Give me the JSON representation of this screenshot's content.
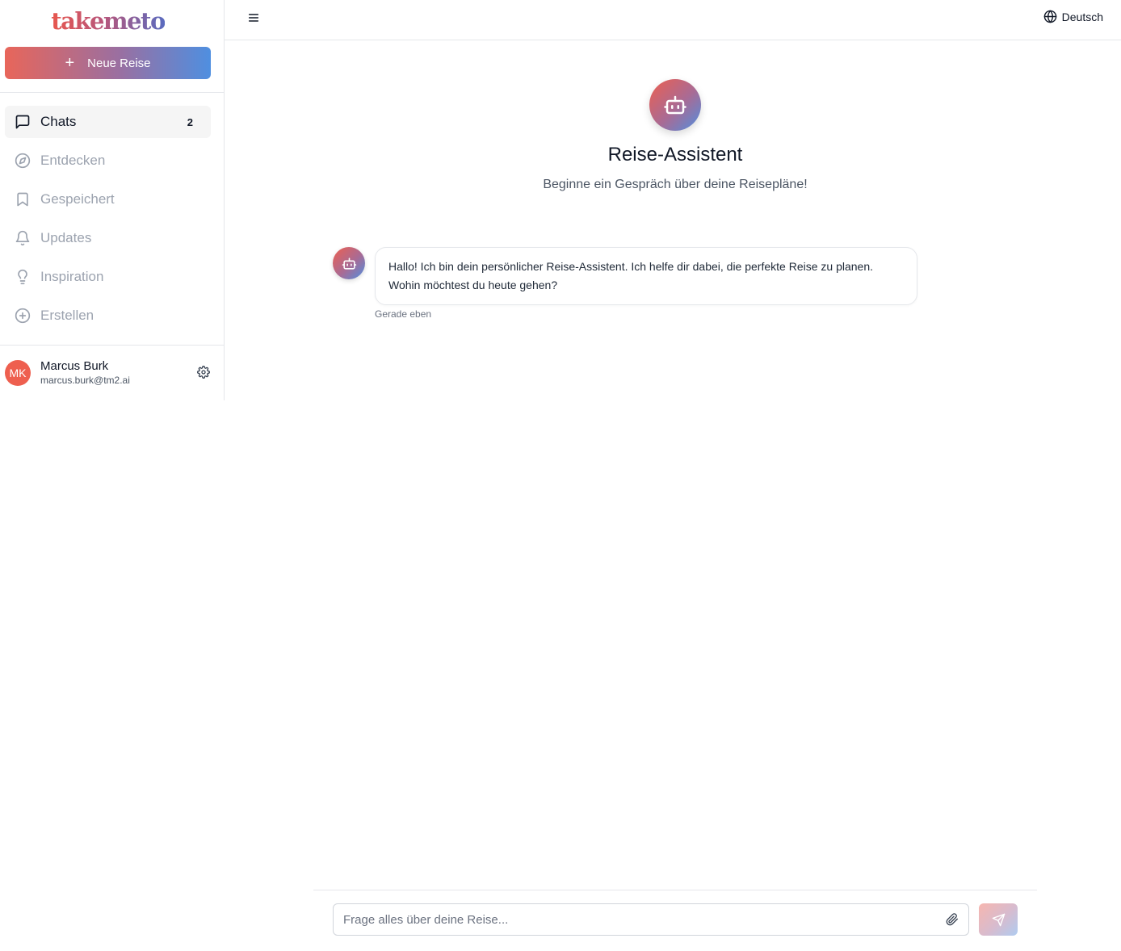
{
  "app": {
    "logo_text": "takemeto"
  },
  "sidebar": {
    "new_trip_label": "Neue Reise",
    "items": [
      {
        "label": "Chats",
        "icon": "message-square-icon",
        "active": true,
        "badge": "2"
      },
      {
        "label": "Entdecken",
        "icon": "compass-icon"
      },
      {
        "label": "Gespeichert",
        "icon": "bookmark-icon"
      },
      {
        "label": "Updates",
        "icon": "bell-icon"
      },
      {
        "label": "Inspiration",
        "icon": "lightbulb-icon"
      },
      {
        "label": "Erstellen",
        "icon": "plus-circle-icon"
      }
    ],
    "user": {
      "initials": "MK",
      "name": "Marcus Burk",
      "email": "marcus.burk@tm2.ai"
    }
  },
  "header": {
    "language": "Deutsch"
  },
  "hero": {
    "title": "Reise-Assistent",
    "subtitle": "Beginne ein Gespräch über deine Reisepläne!"
  },
  "messages": [
    {
      "sender": "bot",
      "text": "Hallo! Ich bin dein persönlicher Reise-Assistent. Ich helfe dir dabei, die perfekte Reise zu planen. Wohin möchtest du heute gehen?",
      "time": "Gerade eben"
    }
  ],
  "composer": {
    "placeholder": "Frage alles über deine Reise..."
  },
  "colors": {
    "accent_start": "#ee5f4f",
    "accent_mid": "#a86b95",
    "accent_end": "#4f8fe0"
  }
}
